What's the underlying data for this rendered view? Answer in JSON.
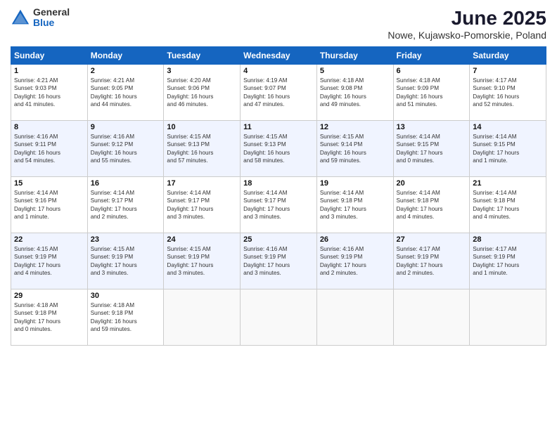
{
  "logo": {
    "general": "General",
    "blue": "Blue"
  },
  "title": "June 2025",
  "location": "Nowe, Kujawsko-Pomorskie, Poland",
  "weekdays": [
    "Sunday",
    "Monday",
    "Tuesday",
    "Wednesday",
    "Thursday",
    "Friday",
    "Saturday"
  ],
  "weeks": [
    [
      {
        "day": "1",
        "text": "Sunrise: 4:21 AM\nSunset: 9:03 PM\nDaylight: 16 hours\nand 41 minutes."
      },
      {
        "day": "2",
        "text": "Sunrise: 4:21 AM\nSunset: 9:05 PM\nDaylight: 16 hours\nand 44 minutes."
      },
      {
        "day": "3",
        "text": "Sunrise: 4:20 AM\nSunset: 9:06 PM\nDaylight: 16 hours\nand 46 minutes."
      },
      {
        "day": "4",
        "text": "Sunrise: 4:19 AM\nSunset: 9:07 PM\nDaylight: 16 hours\nand 47 minutes."
      },
      {
        "day": "5",
        "text": "Sunrise: 4:18 AM\nSunset: 9:08 PM\nDaylight: 16 hours\nand 49 minutes."
      },
      {
        "day": "6",
        "text": "Sunrise: 4:18 AM\nSunset: 9:09 PM\nDaylight: 16 hours\nand 51 minutes."
      },
      {
        "day": "7",
        "text": "Sunrise: 4:17 AM\nSunset: 9:10 PM\nDaylight: 16 hours\nand 52 minutes."
      }
    ],
    [
      {
        "day": "8",
        "text": "Sunrise: 4:16 AM\nSunset: 9:11 PM\nDaylight: 16 hours\nand 54 minutes."
      },
      {
        "day": "9",
        "text": "Sunrise: 4:16 AM\nSunset: 9:12 PM\nDaylight: 16 hours\nand 55 minutes."
      },
      {
        "day": "10",
        "text": "Sunrise: 4:15 AM\nSunset: 9:13 PM\nDaylight: 16 hours\nand 57 minutes."
      },
      {
        "day": "11",
        "text": "Sunrise: 4:15 AM\nSunset: 9:13 PM\nDaylight: 16 hours\nand 58 minutes."
      },
      {
        "day": "12",
        "text": "Sunrise: 4:15 AM\nSunset: 9:14 PM\nDaylight: 16 hours\nand 59 minutes."
      },
      {
        "day": "13",
        "text": "Sunrise: 4:14 AM\nSunset: 9:15 PM\nDaylight: 17 hours\nand 0 minutes."
      },
      {
        "day": "14",
        "text": "Sunrise: 4:14 AM\nSunset: 9:15 PM\nDaylight: 17 hours\nand 1 minute."
      }
    ],
    [
      {
        "day": "15",
        "text": "Sunrise: 4:14 AM\nSunset: 9:16 PM\nDaylight: 17 hours\nand 1 minute."
      },
      {
        "day": "16",
        "text": "Sunrise: 4:14 AM\nSunset: 9:17 PM\nDaylight: 17 hours\nand 2 minutes."
      },
      {
        "day": "17",
        "text": "Sunrise: 4:14 AM\nSunset: 9:17 PM\nDaylight: 17 hours\nand 3 minutes."
      },
      {
        "day": "18",
        "text": "Sunrise: 4:14 AM\nSunset: 9:17 PM\nDaylight: 17 hours\nand 3 minutes."
      },
      {
        "day": "19",
        "text": "Sunrise: 4:14 AM\nSunset: 9:18 PM\nDaylight: 17 hours\nand 3 minutes."
      },
      {
        "day": "20",
        "text": "Sunrise: 4:14 AM\nSunset: 9:18 PM\nDaylight: 17 hours\nand 4 minutes."
      },
      {
        "day": "21",
        "text": "Sunrise: 4:14 AM\nSunset: 9:18 PM\nDaylight: 17 hours\nand 4 minutes."
      }
    ],
    [
      {
        "day": "22",
        "text": "Sunrise: 4:15 AM\nSunset: 9:19 PM\nDaylight: 17 hours\nand 4 minutes."
      },
      {
        "day": "23",
        "text": "Sunrise: 4:15 AM\nSunset: 9:19 PM\nDaylight: 17 hours\nand 3 minutes."
      },
      {
        "day": "24",
        "text": "Sunrise: 4:15 AM\nSunset: 9:19 PM\nDaylight: 17 hours\nand 3 minutes."
      },
      {
        "day": "25",
        "text": "Sunrise: 4:16 AM\nSunset: 9:19 PM\nDaylight: 17 hours\nand 3 minutes."
      },
      {
        "day": "26",
        "text": "Sunrise: 4:16 AM\nSunset: 9:19 PM\nDaylight: 17 hours\nand 2 minutes."
      },
      {
        "day": "27",
        "text": "Sunrise: 4:17 AM\nSunset: 9:19 PM\nDaylight: 17 hours\nand 2 minutes."
      },
      {
        "day": "28",
        "text": "Sunrise: 4:17 AM\nSunset: 9:19 PM\nDaylight: 17 hours\nand 1 minute."
      }
    ],
    [
      {
        "day": "29",
        "text": "Sunrise: 4:18 AM\nSunset: 9:18 PM\nDaylight: 17 hours\nand 0 minutes."
      },
      {
        "day": "30",
        "text": "Sunrise: 4:18 AM\nSunset: 9:18 PM\nDaylight: 16 hours\nand 59 minutes."
      },
      null,
      null,
      null,
      null,
      null
    ]
  ]
}
